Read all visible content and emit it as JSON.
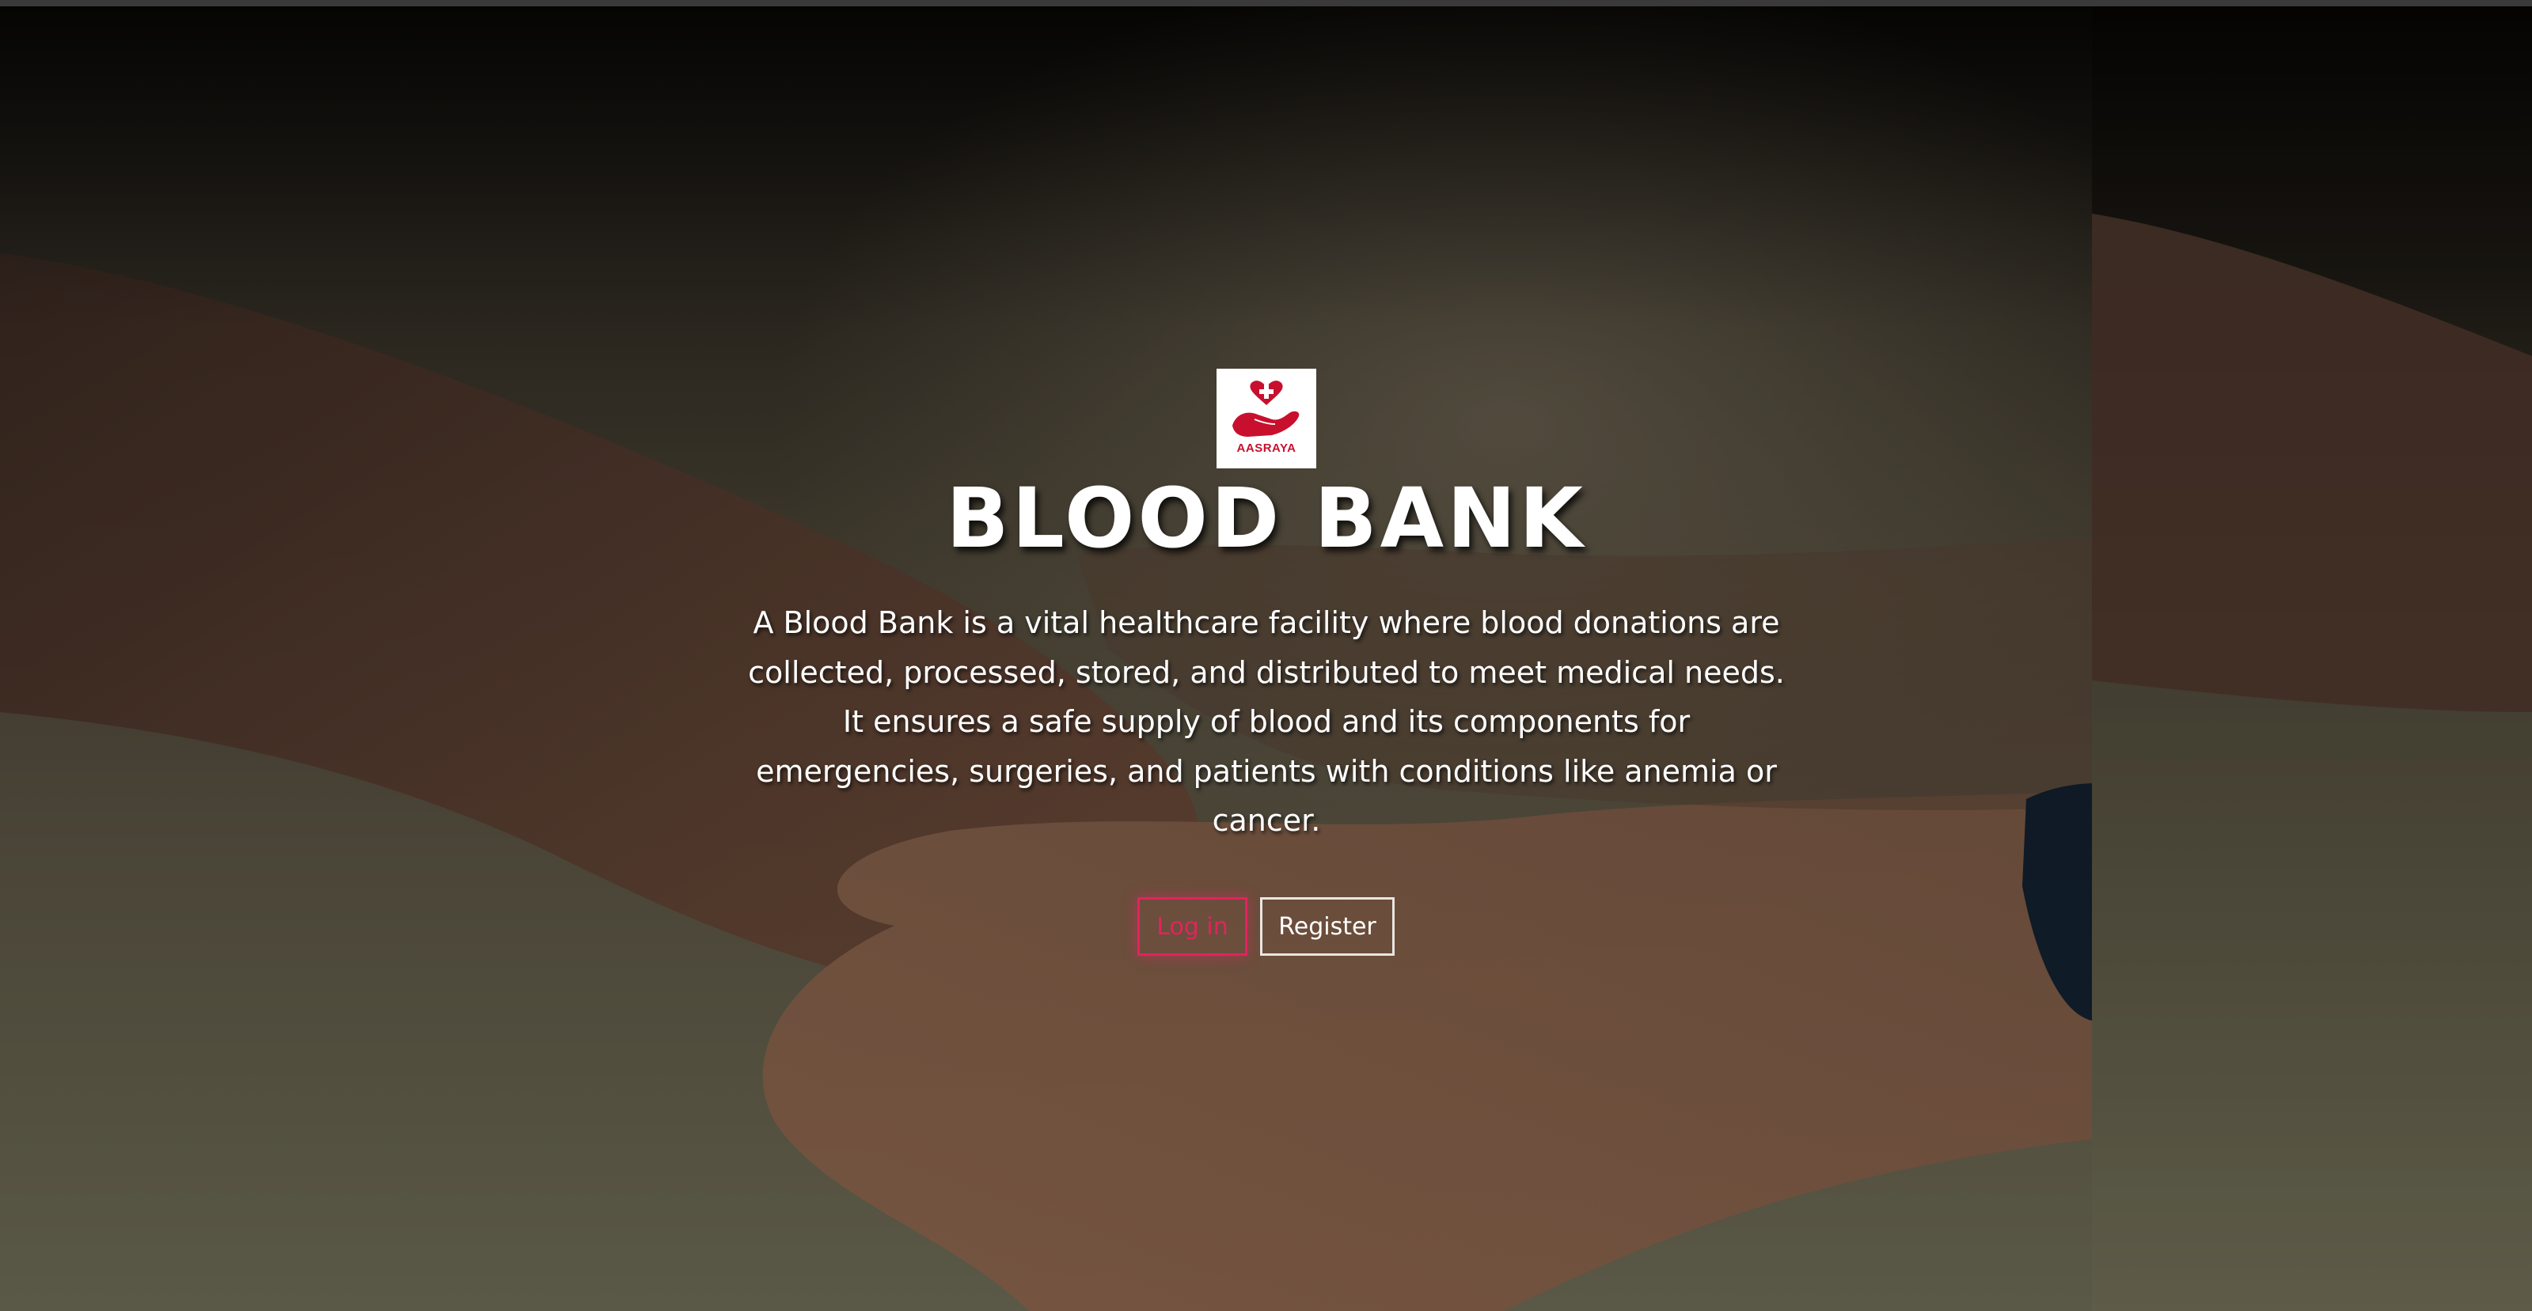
{
  "logo": {
    "icon": "heart-cross-hand-icon",
    "text": "AASRAYA",
    "brand_color": "#c8102e"
  },
  "hero": {
    "title": "BLOOD BANK",
    "description": "A Blood Bank is a vital healthcare facility where blood donations are collected, processed, stored, and distributed to meet medical needs. It ensures a safe supply of blood and its components for emergencies, surgeries, and patients with conditions like anemia or cancer."
  },
  "buttons": {
    "login_label": "Log in",
    "register_label": "Register"
  },
  "colors": {
    "login_accent": "#e0245e",
    "text": "#ffffff"
  }
}
